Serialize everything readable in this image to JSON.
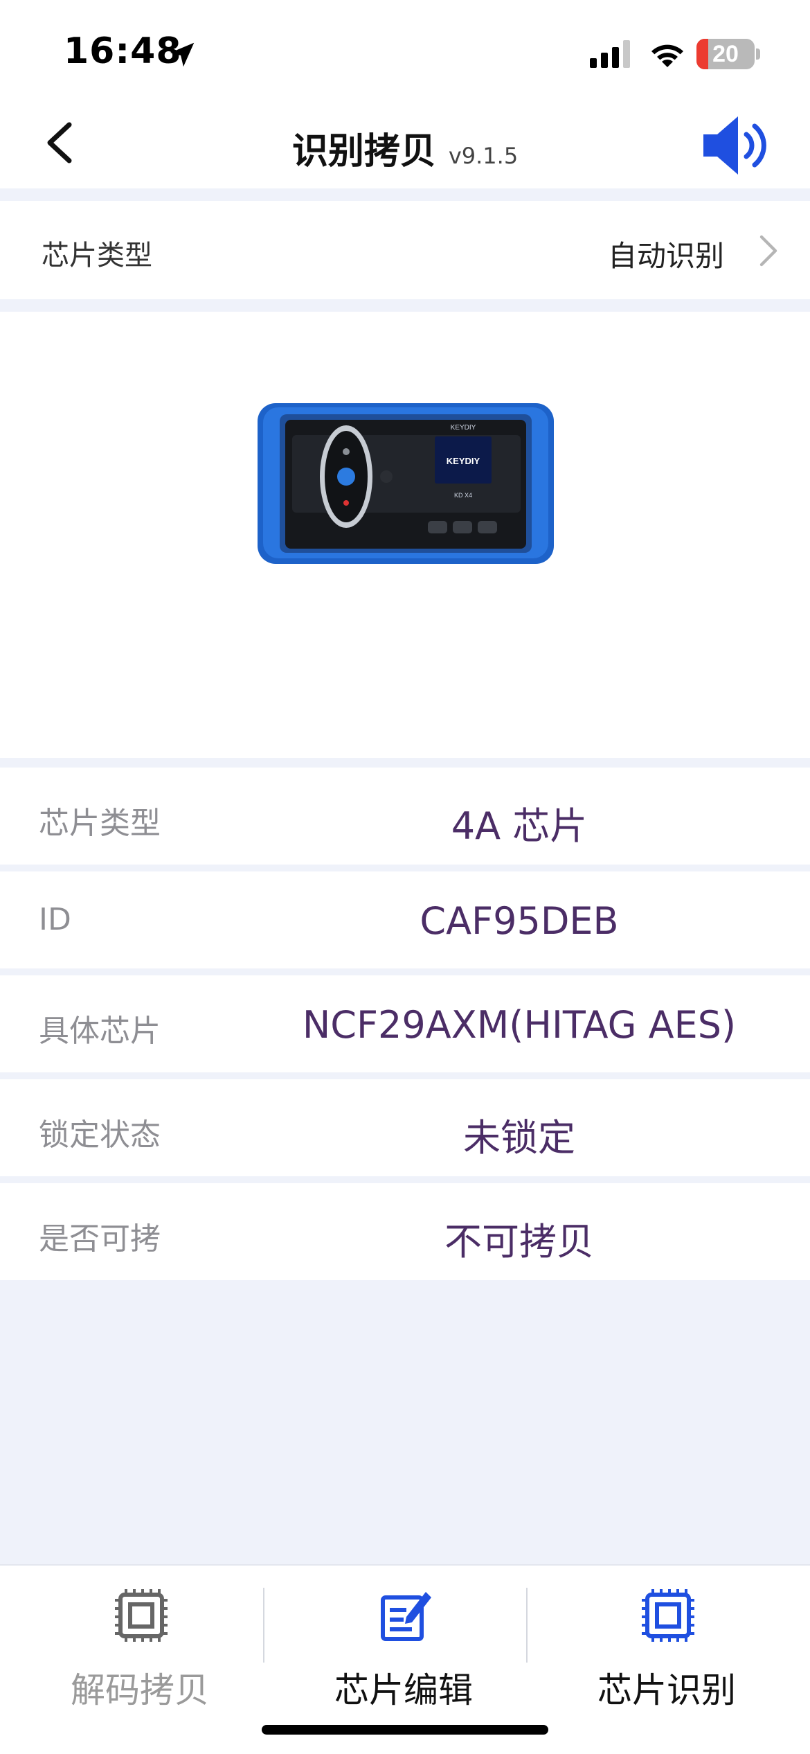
{
  "status_bar": {
    "time": "16:48",
    "battery_level": "20",
    "battery_fraction": 0.2,
    "icons": [
      "location-arrow-icon",
      "cellular-signal-icon",
      "wifi-icon",
      "battery-icon"
    ]
  },
  "nav": {
    "title": "识别拷贝",
    "version": "v9.1.5",
    "back_icon": "chevron-left-icon",
    "sound_icon": "speaker-volume-icon"
  },
  "selector": {
    "label": "芯片类型",
    "value": "自动识别"
  },
  "device": {
    "brand": "KEYDIY",
    "model": "KD X4"
  },
  "info": [
    {
      "key": "芯片类型",
      "value": "4A 芯片"
    },
    {
      "key": "ID",
      "value": "CAF95DEB"
    },
    {
      "key": "具体芯片",
      "value": "NCF29AXM(HITAG AES)"
    },
    {
      "key": "锁定状态",
      "value": "未锁定"
    },
    {
      "key": "是否可拷",
      "value": "不可拷贝"
    }
  ],
  "tabs": [
    {
      "label": "解码拷贝",
      "icon": "chip-outline-icon",
      "active": false
    },
    {
      "label": "芯片编辑",
      "icon": "edit-note-icon",
      "active": true
    },
    {
      "label": "芯片识别",
      "icon": "chip-scan-icon",
      "active": true
    }
  ],
  "colors": {
    "accent_blue": "#1f4fe0",
    "value_purple": "#4b2d66",
    "background": "#eff2fa",
    "inactive_gray": "#9a9a9a"
  }
}
